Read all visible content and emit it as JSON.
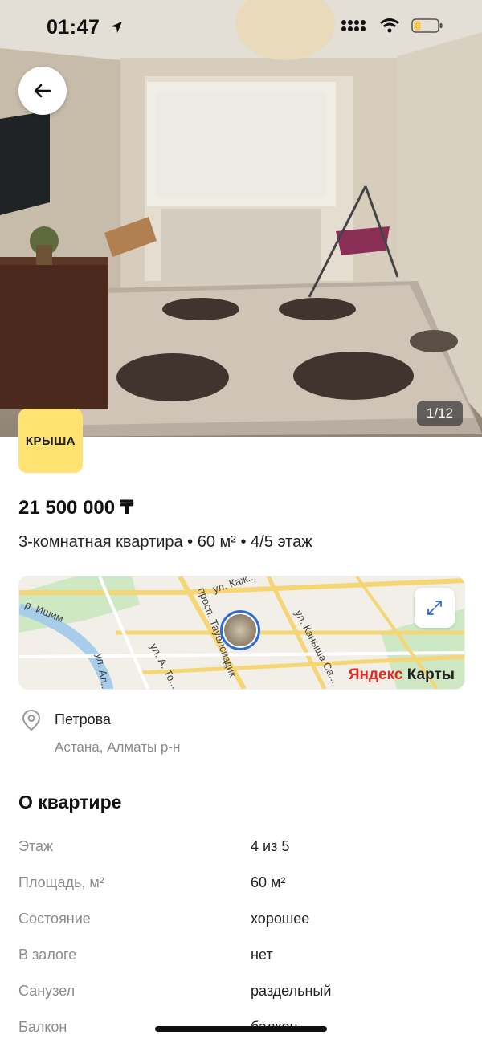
{
  "status_bar": {
    "time": "01:47"
  },
  "photo": {
    "counter": "1/12"
  },
  "agency_logo": {
    "text": "КРЫША"
  },
  "listing": {
    "price": "21 500 000 ₸",
    "summary": "3-комнатная квартира • 60 м² • 4/5 этаж"
  },
  "map": {
    "brand_ya": "Яндекс",
    "brand_rest": " Карты",
    "streets": [
      "ул. Каж...",
      "просп. Тауелсиздик",
      "ул. Каныша Са...",
      "р. Ишим",
      "ул. А. То...",
      "ул. Ал..."
    ]
  },
  "address": {
    "street": "Петрова",
    "city_district": "Астана, Алматы р-н"
  },
  "about": {
    "title": "О квартире",
    "specs": [
      {
        "label": "Этаж",
        "value": "4 из 5"
      },
      {
        "label": "Площадь, м²",
        "value": "60 м²"
      },
      {
        "label": "Состояние",
        "value": "хорошее"
      },
      {
        "label": "В залоге",
        "value": "нет"
      },
      {
        "label": "Санузел",
        "value": "раздельный"
      },
      {
        "label": "Балкон",
        "value": "балкон"
      }
    ]
  }
}
